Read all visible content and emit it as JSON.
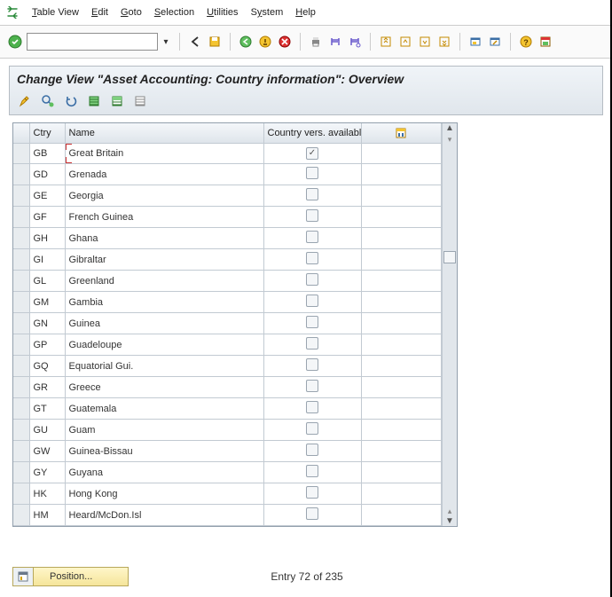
{
  "menu": {
    "items": [
      {
        "label": "Table View",
        "ul": "T"
      },
      {
        "label": "Edit",
        "ul": "E"
      },
      {
        "label": "Goto",
        "ul": "G"
      },
      {
        "label": "Selection",
        "ul": "S"
      },
      {
        "label": "Utilities",
        "ul": "U"
      },
      {
        "label": "System",
        "ul": "y",
        "pos": 1
      },
      {
        "label": "Help",
        "ul": "H"
      }
    ]
  },
  "toolbar": {
    "primary_icons": [
      "check",
      "back",
      "save",
      "back2",
      "exit",
      "cancel",
      "print",
      "find",
      "findnext",
      "first",
      "prev",
      "next",
      "last",
      "newwin",
      "shortcut",
      "help",
      "customizing"
    ]
  },
  "title": "Change View \"Asset Accounting: Country information\": Overview",
  "subtoolbar_icons": [
    "change",
    "check-inp",
    "undo",
    "select-all",
    "deselect-all",
    "config"
  ],
  "columns": {
    "ctry": "Ctry",
    "name": "Name",
    "avail": "Country vers. available"
  },
  "chart_data": {
    "type": "table",
    "title": "Asset Accounting: Country information",
    "columns": [
      "Ctry",
      "Name",
      "Country vers. available"
    ],
    "rows": [
      [
        "GB",
        "Great Britain",
        true
      ],
      [
        "GD",
        "Grenada",
        false
      ],
      [
        "GE",
        "Georgia",
        false
      ],
      [
        "GF",
        "French Guinea",
        false
      ],
      [
        "GH",
        "Ghana",
        false
      ],
      [
        "GI",
        "Gibraltar",
        false
      ],
      [
        "GL",
        "Greenland",
        false
      ],
      [
        "GM",
        "Gambia",
        false
      ],
      [
        "GN",
        "Guinea",
        false
      ],
      [
        "GP",
        "Guadeloupe",
        false
      ],
      [
        "GQ",
        "Equatorial Gui.",
        false
      ],
      [
        "GR",
        "Greece",
        false
      ],
      [
        "GT",
        "Guatemala",
        false
      ],
      [
        "GU",
        "Guam",
        false
      ],
      [
        "GW",
        "Guinea-Bissau",
        false
      ],
      [
        "GY",
        "Guyana",
        false
      ],
      [
        "HK",
        "Hong Kong",
        false
      ],
      [
        "HM",
        "Heard/McDon.Isl",
        false
      ]
    ]
  },
  "footer": {
    "position_label": "Position...",
    "entry_text": "Entry 72 of 235"
  }
}
